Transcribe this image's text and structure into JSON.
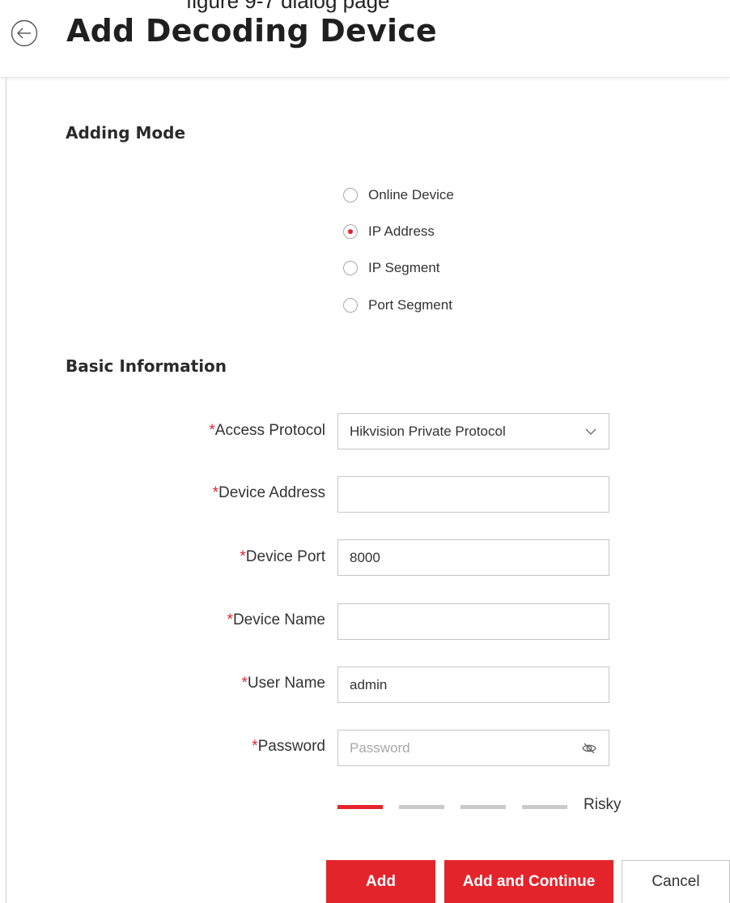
{
  "header": {
    "clipped_text": "figure 9-7 dialog page",
    "title": "Add Decoding Device",
    "back_icon": "back-arrow-icon"
  },
  "adding_mode": {
    "title": "Adding Mode",
    "options": [
      {
        "label": "Online Device",
        "checked": false
      },
      {
        "label": "IP Address",
        "checked": true
      },
      {
        "label": "IP Segment",
        "checked": false
      },
      {
        "label": "Port Segment",
        "checked": false
      }
    ]
  },
  "basic_info": {
    "title": "Basic Information",
    "required_mark": "*",
    "access_protocol": {
      "label": "Access Protocol",
      "value": "Hikvision Private Protocol"
    },
    "device_address": {
      "label": "Device Address",
      "value": ""
    },
    "device_port": {
      "label": "Device Port",
      "value": "8000"
    },
    "device_name": {
      "label": "Device Name",
      "value": ""
    },
    "user_name": {
      "label": "User Name",
      "value": "admin"
    },
    "password": {
      "label": "Password",
      "placeholder": "Password",
      "value": ""
    },
    "strength": {
      "label": "Risky",
      "level": 1,
      "max": 4
    }
  },
  "buttons": {
    "add": "Add",
    "add_continue": "Add and Continue",
    "cancel": "Cancel"
  },
  "colors": {
    "accent": "#e4242b",
    "inactive_bar": "#c9c9c9"
  }
}
